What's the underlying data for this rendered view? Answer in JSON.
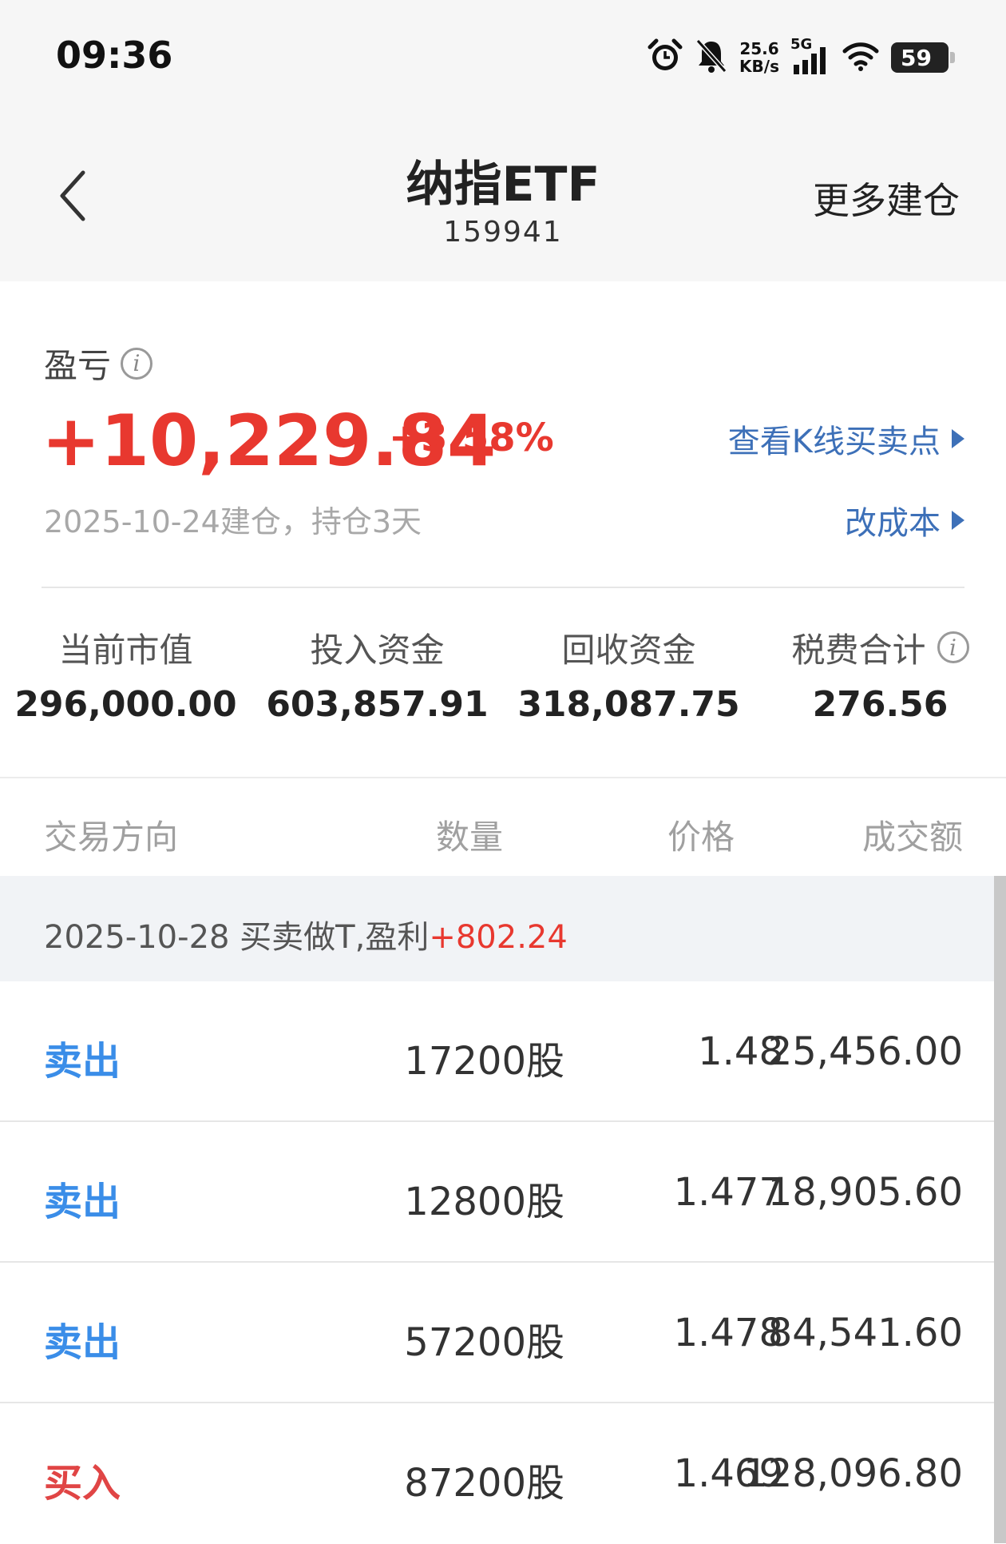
{
  "status_bar": {
    "time": "09:36",
    "speed_top": "25.6",
    "speed_bottom": "KB/s",
    "network": "5G",
    "battery": "59",
    "icons": [
      "alarm-icon",
      "bell-off-icon",
      "signal-icon",
      "wifi-icon",
      "battery-icon"
    ]
  },
  "nav": {
    "title": "纳指ETF",
    "code": "159941",
    "more_label": "更多建仓"
  },
  "summary": {
    "pl_label": "盈亏",
    "pl_value": "+10,229.84",
    "pl_pct": "+3.58%",
    "kline_link": "查看K线买卖点",
    "position_info": "2025-10-24建仓，持仓3天",
    "cost_link": "改成本",
    "profit_color": "#e8382f",
    "link_color": "#3d70b8"
  },
  "stats": [
    {
      "label": "当前市值",
      "value": "296,000.00"
    },
    {
      "label": "投入资金",
      "value": "603,857.91"
    },
    {
      "label": "回收资金",
      "value": "318,087.75"
    },
    {
      "label": "税费合计",
      "value": "276.56"
    }
  ],
  "table": {
    "headers": {
      "direction": "交易方向",
      "quantity": "数量",
      "price": "价格",
      "amount": "成交额"
    },
    "group": {
      "text": "2025-10-28 买卖做T,盈利",
      "profit": "+802.24"
    },
    "rows": [
      {
        "direction": "卖出",
        "quantity": "17200股",
        "price": "1.48",
        "amount": "25,456.00"
      },
      {
        "direction": "卖出",
        "quantity": "12800股",
        "price": "1.477",
        "amount": "18,905.60"
      },
      {
        "direction": "卖出",
        "quantity": "57200股",
        "price": "1.478",
        "amount": "84,541.60"
      },
      {
        "direction": "买入",
        "quantity": "87200股",
        "price": "1.469",
        "amount": "128,096.80"
      }
    ],
    "sell_color": "#3a8de8",
    "buy_color": "#e04545"
  }
}
